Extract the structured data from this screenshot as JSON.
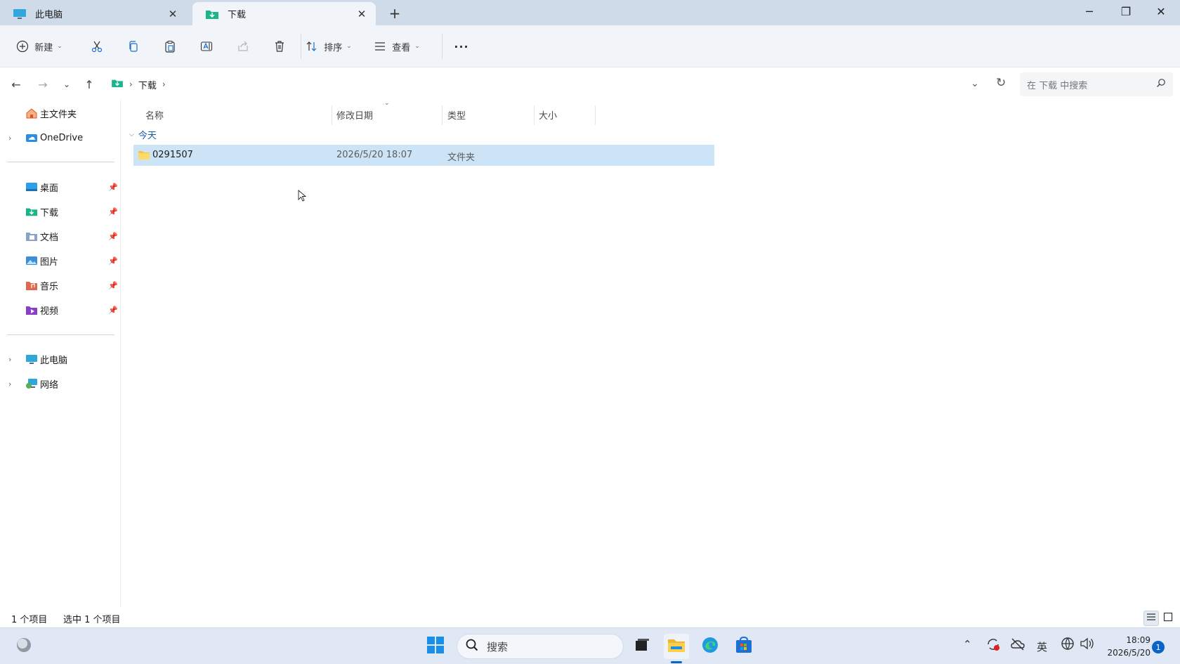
{
  "tabs": [
    {
      "label": "此电脑",
      "icon": "monitor-icon"
    },
    {
      "label": "下载",
      "icon": "downloads-folder-icon"
    }
  ],
  "window": {
    "new_tab": "+",
    "minimize": "─",
    "restore": "❐",
    "close": "✕"
  },
  "toolbar": {
    "new_label": "新建",
    "sort_label": "排序",
    "view_label": "查看",
    "more_label": "···"
  },
  "address": {
    "crumbs": [
      "下载"
    ],
    "search_placeholder": "在 下载 中搜索"
  },
  "sidebar": {
    "top": [
      {
        "label": "主文件夹",
        "icon": "home-icon",
        "expandable": false
      },
      {
        "label": "OneDrive",
        "icon": "onedrive-icon",
        "expandable": true
      }
    ],
    "pinned": [
      {
        "label": "桌面",
        "icon": "desktop-icon"
      },
      {
        "label": "下载",
        "icon": "downloads-icon"
      },
      {
        "label": "文档",
        "icon": "documents-icon"
      },
      {
        "label": "图片",
        "icon": "pictures-icon"
      },
      {
        "label": "音乐",
        "icon": "music-icon"
      },
      {
        "label": "视频",
        "icon": "videos-icon"
      }
    ],
    "bottom": [
      {
        "label": "此电脑",
        "icon": "this-pc-icon"
      },
      {
        "label": "网络",
        "icon": "network-icon"
      }
    ]
  },
  "columns": {
    "name": "名称",
    "date": "修改日期",
    "type": "类型",
    "size": "大小"
  },
  "group": {
    "label": "今天"
  },
  "files": [
    {
      "name": "0291507",
      "date": "2026/5/20 18:07",
      "type": "文件夹",
      "size": "",
      "selected": true
    }
  ],
  "status": {
    "count": "1 个项目",
    "selected": "选中 1 个项目"
  },
  "taskbar": {
    "search_label": "搜索",
    "ime": "英",
    "time": "18:09",
    "date": "2026/5/20",
    "notification_count": "1"
  },
  "colors": {
    "tabbar_bg": "#cfdbe8",
    "selection": "#cde4f7",
    "accent": "#0a64c8",
    "group_text": "#1b57a8"
  }
}
